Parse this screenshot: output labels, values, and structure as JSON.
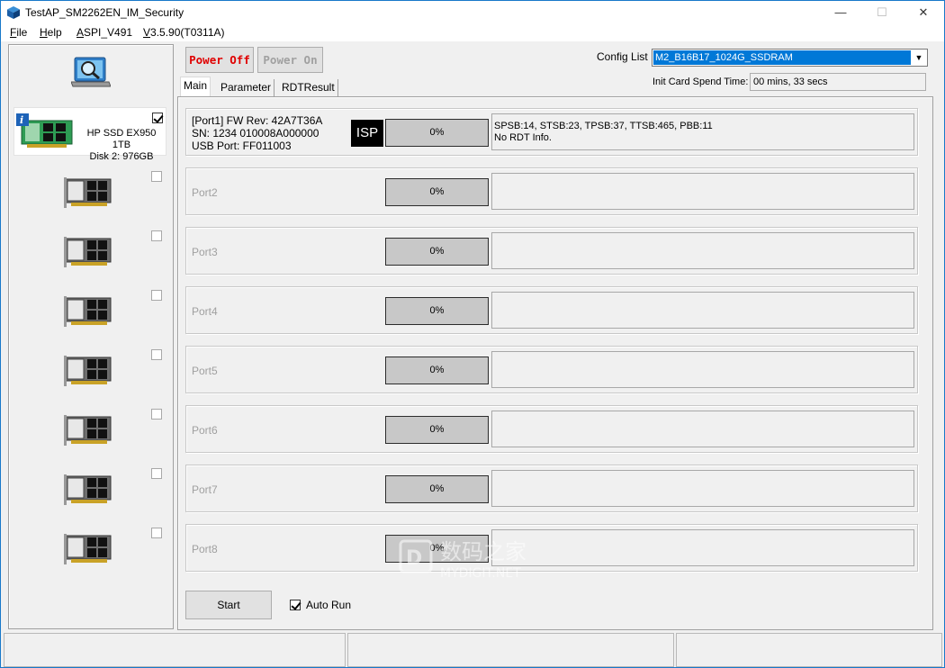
{
  "window": {
    "title": "TestAP_SM2262EN_IM_Security",
    "minimize_glyph": "—",
    "maximize_glyph": "☐",
    "close_glyph": "✕",
    "icon": "cube-icon"
  },
  "menu": {
    "items": [
      {
        "label": "File",
        "accel": "F",
        "rest": "ile"
      },
      {
        "label": "Help",
        "accel": "H",
        "rest": "elp"
      },
      {
        "label": "ASPI_V491",
        "accel": "A",
        "rest": "SPI_V491"
      },
      {
        "label": "V3.5.90(T0311A)",
        "accel": "V",
        "rest": "3.5.90(T0311A)"
      }
    ]
  },
  "toolbar": {
    "power_off": "Power Off",
    "power_on": "Power On",
    "power_off_color": "#e00000",
    "power_on_color": "#a0a0a0"
  },
  "config": {
    "label": "Config List",
    "selected": "M2_B16B17_1024G_SSDRAM",
    "spend_label": "Init Card Spend Time:",
    "spend_value": "00 mins, 33 secs"
  },
  "tabs": [
    {
      "label": "Main",
      "active": true
    },
    {
      "label": "Parameter",
      "active": false
    },
    {
      "label": "RDTResult",
      "active": false
    }
  ],
  "disks": [
    {
      "name": "HP SSD EX950 1TB",
      "detail": "Disk 2:  976GB",
      "checked": true,
      "active": true
    },
    {
      "checked": false,
      "active": false
    },
    {
      "checked": false,
      "active": false
    },
    {
      "checked": false,
      "active": false
    },
    {
      "checked": false,
      "active": false
    },
    {
      "checked": false,
      "active": false
    },
    {
      "checked": false,
      "active": false
    },
    {
      "checked": false,
      "active": false
    }
  ],
  "ports": [
    {
      "label": "[Port1] FW Rev: 42A7T36A",
      "sn": "SN: 1234   010008A000000",
      "usb": "USB Port: FF011003",
      "isp": "ISP",
      "progress": "0%",
      "status1": "SPSB:14, STSB:23, TPSB:37, TTSB:465, PBB:11",
      "status2": "No RDT Info."
    },
    {
      "label": "Port2",
      "progress": "0%"
    },
    {
      "label": "Port3",
      "progress": "0%"
    },
    {
      "label": "Port4",
      "progress": "0%"
    },
    {
      "label": "Port5",
      "progress": "0%"
    },
    {
      "label": "Port6",
      "progress": "0%"
    },
    {
      "label": "Port7",
      "progress": "0%"
    },
    {
      "label": "Port8",
      "progress": "0%"
    }
  ],
  "footer": {
    "start": "Start",
    "auto_run": "Auto Run",
    "auto_run_checked": true
  },
  "watermark": {
    "cn": "数码之家",
    "en": "MYDIGIT.NET"
  }
}
